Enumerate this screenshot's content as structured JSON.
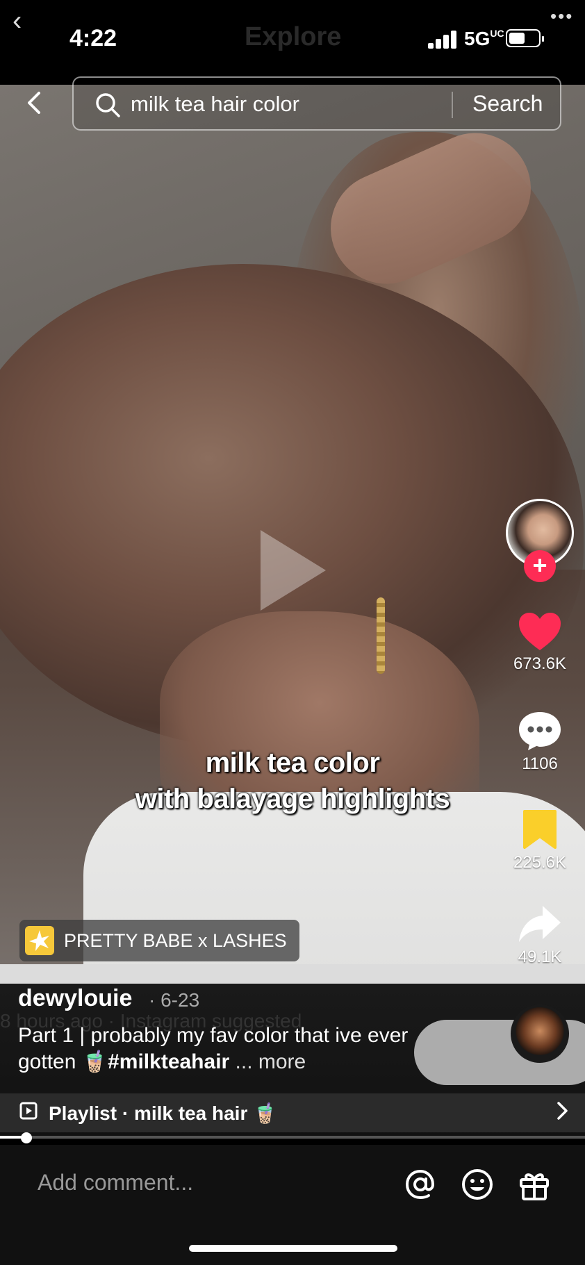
{
  "status_bar": {
    "time": "4:22",
    "ghost_title": "Explore",
    "network": "5G",
    "network_sub": "UC",
    "battery": "battery-icon"
  },
  "search": {
    "query": "milk tea hair color",
    "button_label": "Search"
  },
  "video": {
    "caption_line1": "milk tea color",
    "caption_line2": "with balayage highlights",
    "effect_label": "PRETTY BABE x LASHES"
  },
  "rail": {
    "likes": "673.6K",
    "comments": "1106",
    "saves": "225.6K",
    "shares": "49.1K",
    "follow_label": "+"
  },
  "info": {
    "author": "dewylouie",
    "date": "· 6-23",
    "ghost_text": "8 hours ago · Instagram suggested",
    "desc_prefix": "Part 1 | probably my fav color that ive ever gotten 🧋",
    "hashtag": "#milkteahair",
    "more": " ... more"
  },
  "playlist": {
    "label": "Playlist · milk tea hair 🧋"
  },
  "progress": {
    "fraction": 0.045
  },
  "comment_bar": {
    "placeholder": "Add comment..."
  },
  "colors": {
    "like_red": "#fe2c55",
    "save_yellow": "#facf2a"
  }
}
